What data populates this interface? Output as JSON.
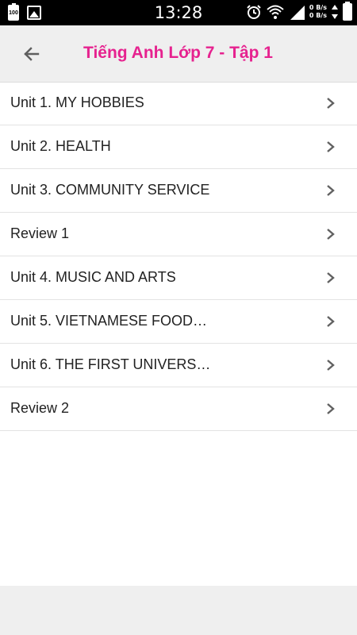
{
  "status_bar": {
    "time": "13:28",
    "battery_small_level": "100",
    "net_speed_up": "0 B/s",
    "net_speed_down": "0 B/s",
    "icons": [
      "battery-icon",
      "gallery-icon",
      "alarm-icon",
      "wifi-icon",
      "signal-icon",
      "battery-icon"
    ]
  },
  "header": {
    "title": "Tiếng Anh Lớp 7 - Tập 1",
    "back_icon": "arrow-left-icon",
    "title_color": "#e6228f"
  },
  "list": {
    "items": [
      {
        "label": "Unit 1. MY HOBBIES"
      },
      {
        "label": "Unit 2. HEALTH"
      },
      {
        "label": "Unit 3. COMMUNITY SERVICE"
      },
      {
        "label": "Review 1"
      },
      {
        "label": "Unit 4. MUSIC AND ARTS"
      },
      {
        "label": "Unit 5. VIETNAMESE FOOD…"
      },
      {
        "label": "Unit 6. THE FIRST UNIVERS…"
      },
      {
        "label": "Review 2"
      }
    ],
    "chevron_icon": "chevron-right-icon"
  }
}
